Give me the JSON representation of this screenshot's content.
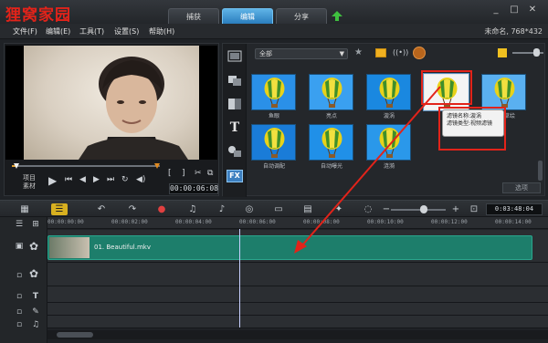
{
  "logo": "狸窝家园",
  "mode_tabs": [
    "捕获",
    "编辑",
    "分享"
  ],
  "menu": [
    "文件(F)",
    "编辑(E)",
    "工具(T)",
    "设置(S)",
    "帮助(H)"
  ],
  "project_info": "未命名, 768*432",
  "preview": {
    "mode_project": "项目",
    "mode_clip": "素材",
    "timecode": "00:00:06:08"
  },
  "library": {
    "filter": "全部",
    "option_label": "选项",
    "thumb_labels": [
      "鱼眼",
      "亮点",
      "漩涡",
      "",
      "自动草绘",
      "自动调配",
      "自动曝光",
      "涟漪"
    ],
    "tooltip": [
      "滤镜名称:漩涡",
      "滤镜类型:视频滤镜"
    ]
  },
  "timeline": {
    "total_time": "0:03:48:04",
    "ruler": [
      "00:00:00:00",
      "00:00:02:00",
      "00:00:04:00",
      "00:00:06:00",
      "00:00:08:00",
      "00:00:10:00",
      "00:00:12:00",
      "00:00:14:00"
    ],
    "clip_name": "01. Beautiful.mkv"
  },
  "colors": {
    "accent_blue": "#2a7dbd",
    "clip_teal": "#1d7e6b",
    "annotation_red": "#e2231a"
  }
}
